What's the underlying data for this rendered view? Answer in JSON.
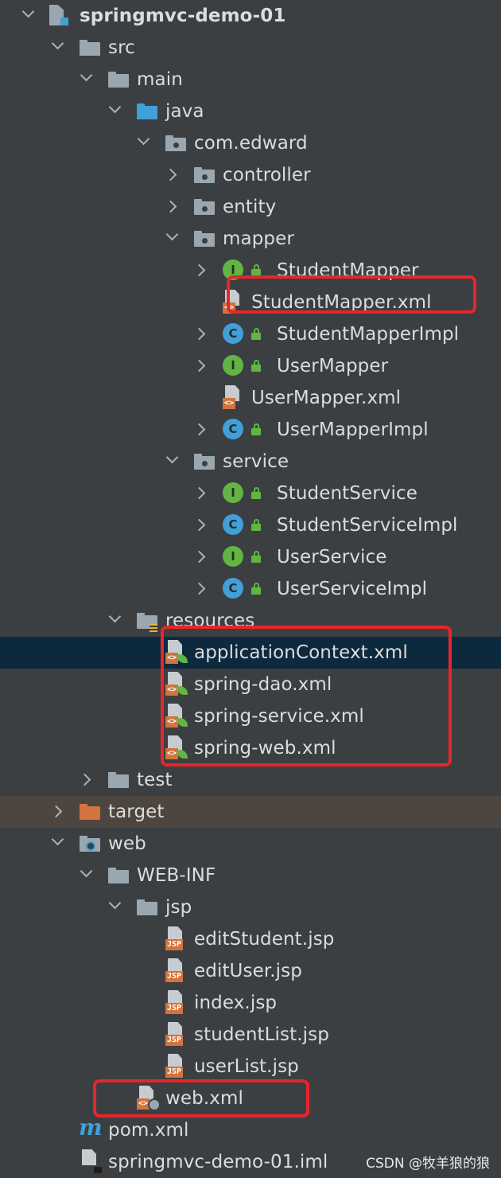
{
  "tree": {
    "project": "springmvc-demo-01",
    "src": "src",
    "main": "main",
    "java": "java",
    "package": "com.edward",
    "controller": "controller",
    "entity": "entity",
    "mapper": "mapper",
    "student_mapper": "StudentMapper",
    "student_mapper_xml": "StudentMapper.xml",
    "student_mapper_impl": "StudentMapperImpl",
    "user_mapper": "UserMapper",
    "user_mapper_xml": "UserMapper.xml",
    "user_mapper_impl": "UserMapperImpl",
    "service": "service",
    "student_service": "StudentService",
    "student_service_impl": "StudentServiceImpl",
    "user_service": "UserService",
    "user_service_impl": "UserServiceImpl",
    "resources": "resources",
    "application_context": "applicationContext.xml",
    "spring_dao": "spring-dao.xml",
    "spring_service": "spring-service.xml",
    "spring_web": "spring-web.xml",
    "test": "test",
    "target": "target",
    "web": "web",
    "web_inf": "WEB-INF",
    "jsp": "jsp",
    "edit_student": "editStudent.jsp",
    "edit_user": "editUser.jsp",
    "index": "index.jsp",
    "student_list": "studentList.jsp",
    "user_list": "userList.jsp",
    "web_xml": "web.xml",
    "pom": "pom.xml",
    "iml": "springmvc-demo-01.iml"
  },
  "icons": {
    "interface_letter": "I",
    "class_letter": "C",
    "maven_letter": "m",
    "xml_tag": "<>",
    "jsp_tag": "JSP"
  },
  "watermark": "CSDN @牧羊狼的狼",
  "colors": {
    "background": "#3c3f41",
    "selected_row": "#0d293e",
    "excluded_row": "#4d4640",
    "highlight_box": "#e8252b",
    "folder": "#9aa7b0",
    "source_folder": "#40a0d8",
    "target_folder": "#d3733d"
  }
}
